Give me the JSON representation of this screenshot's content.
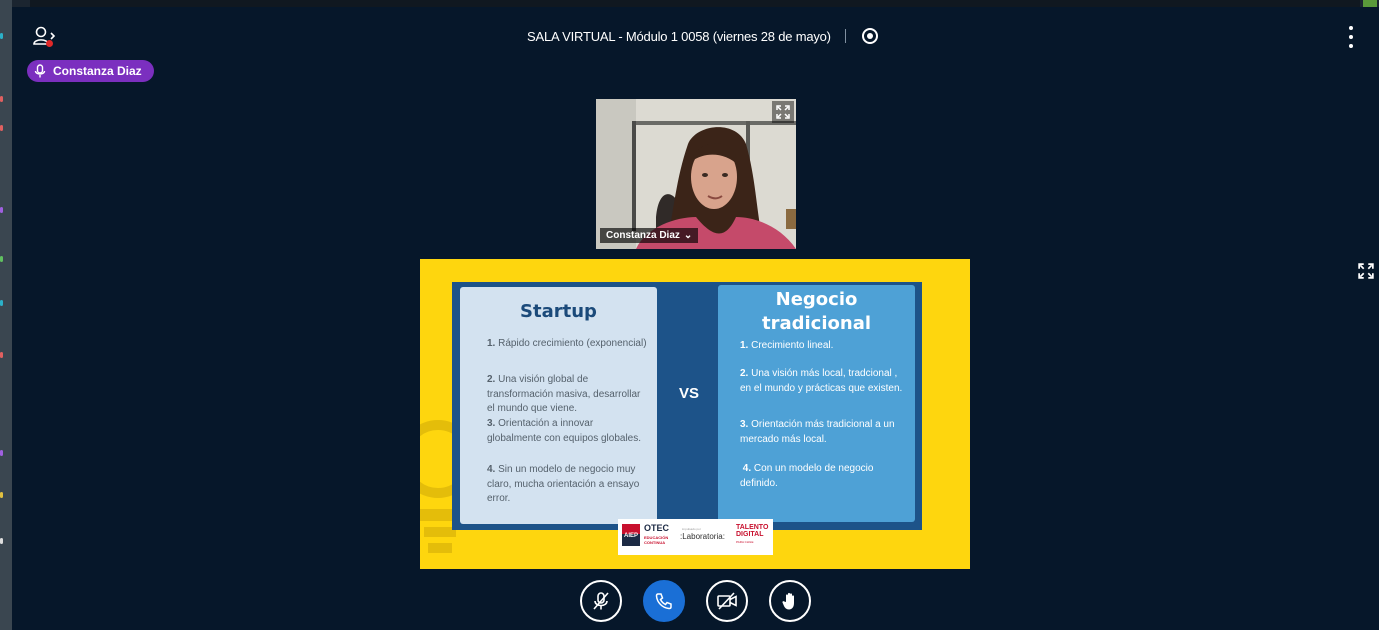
{
  "header": {
    "title": "SALA VIRTUAL - Módulo 1 0058 (viernes 28 de mayo)",
    "icons": {
      "users": "users-icon",
      "record": "record-icon",
      "options": "more-vertical-icon"
    }
  },
  "talking_indicator": {
    "name": "Constanza Diaz",
    "icon": "microphone-icon"
  },
  "webcam": {
    "user_name": "Constanza Diaz",
    "dropdown_glyph": "⌄",
    "icon": "fullscreen-icon"
  },
  "presentation": {
    "left_card": {
      "title": "Startup",
      "items": [
        {
          "num": "1.",
          "text": "Rápido crecimiento (exponencial)"
        },
        {
          "num": "2.",
          "text": "Una visión global de transformación masiva, desarrollar el mundo que viene."
        },
        {
          "num": "3.",
          "text": "Orientación a innovar globalmente con equipos globales."
        },
        {
          "num": "4.",
          "text": "Sin un modelo de negocio muy claro, mucha orientación a ensayo error."
        }
      ]
    },
    "vs": "VS",
    "right_card": {
      "title_line1": "Negocio",
      "title_line2": "tradicional",
      "items": [
        {
          "num": "1.",
          "text": "Crecimiento lineal."
        },
        {
          "num": "2.",
          "text": "Una visión más local, tradcional , en el mundo y prácticas que existen."
        },
        {
          "num": "3.",
          "text": "Orientación más tradicional a un mercado más local."
        },
        {
          "num": "4.",
          "text": "Con un modelo de negocio definido."
        }
      ]
    },
    "logos": {
      "aiep": "AIEP",
      "otec": "OTEC",
      "otec_sub": "EDUCACIÓN CONTINUA",
      "laboratoria_pre": "impulsado por",
      "laboratoria": ":Laboratoria:",
      "talento": "TALENTO DIGITAL",
      "talento_sub": "PARA CHILE"
    }
  },
  "actions_bar": {
    "buttons": [
      {
        "name": "unmute",
        "icon": "microphone-muted-icon"
      },
      {
        "name": "leave-audio",
        "icon": "phone-icon"
      },
      {
        "name": "share-webcam",
        "icon": "video-off-icon"
      },
      {
        "name": "raise-hand",
        "icon": "hand-icon"
      }
    ]
  },
  "colors": {
    "background": "#06172a",
    "talking": "#7b2fbf",
    "primary": "#1a6fd6",
    "slide_yellow": "#fed60e",
    "slide_dark_blue": "#1d5389",
    "slide_light_card": "#d3e2f0",
    "slide_blue_card": "#4ea1d6"
  }
}
